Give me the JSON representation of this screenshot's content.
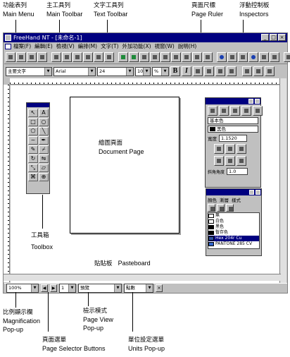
{
  "callouts": {
    "main_menu": {
      "zh": "功能表列",
      "en": "Main Menu"
    },
    "main_toolbar": {
      "zh": "主工具列",
      "en": "Main Toolbar"
    },
    "text_toolbar": {
      "zh": "文字工具列",
      "en": "Text Toolbar"
    },
    "page_ruler": {
      "zh": "頁面尺標",
      "en": "Page Ruler"
    },
    "inspectors": {
      "zh": "浮動控制板",
      "en": "Inspectors"
    },
    "toolbox": {
      "zh": "工具箱",
      "en": "Toolbox"
    },
    "document_page": {
      "zh": "繪圖頁面",
      "en": "Document Page"
    },
    "pasteboard": {
      "zh": "貼貼板",
      "en": "Pasteboard"
    },
    "magnification": {
      "zh": "比例顯示欄",
      "en": "Magnification",
      "en2": "Pop-up"
    },
    "page_selector": {
      "zh": "頁面選單",
      "en": "Page Selector Buttons"
    },
    "page_view": {
      "zh": "檢示模式",
      "en": "Page View",
      "en2": "Pop-up"
    },
    "units": {
      "zh": "單位設定選單",
      "en": "Units Pop-up"
    }
  },
  "window": {
    "title": "FreeHand NT - [未命名-1]",
    "menu": [
      "檔案(F)",
      "編輯(E)",
      "檢視(V)",
      "編排(M)",
      "文字(T)",
      "外加功能(X)",
      "視窗(W)",
      "說明(H)"
    ]
  },
  "text_toolbar": {
    "style": "主要文字",
    "font": "Arial",
    "size": "24",
    "leading": "100",
    "leading_unit": "%",
    "buttons": [
      "B",
      "I"
    ]
  },
  "status": {
    "magnification": "100%",
    "page": "1",
    "view": "預覽",
    "units": "點數"
  },
  "inspector": {
    "fill": "基本色",
    "color": "黑色",
    "width_label": "寬度",
    "width": "1.1520",
    "miter_label": "斜角角度",
    "miter": "1.0"
  },
  "color_list": {
    "tabs": [
      "顏色",
      "漸層",
      "樣式"
    ],
    "items": [
      {
        "label": "無",
        "color": "#ffffff"
      },
      {
        "label": "白色",
        "color": "#ffffff"
      },
      {
        "label": "黑色",
        "color": "#000000"
      },
      {
        "label": "暫存色",
        "color": "#000000"
      },
      {
        "label": "Hex 204r Cu",
        "color": "#2e4fa0"
      },
      {
        "label": "PANTONE 285 CV",
        "color": "#3366cc"
      }
    ]
  }
}
